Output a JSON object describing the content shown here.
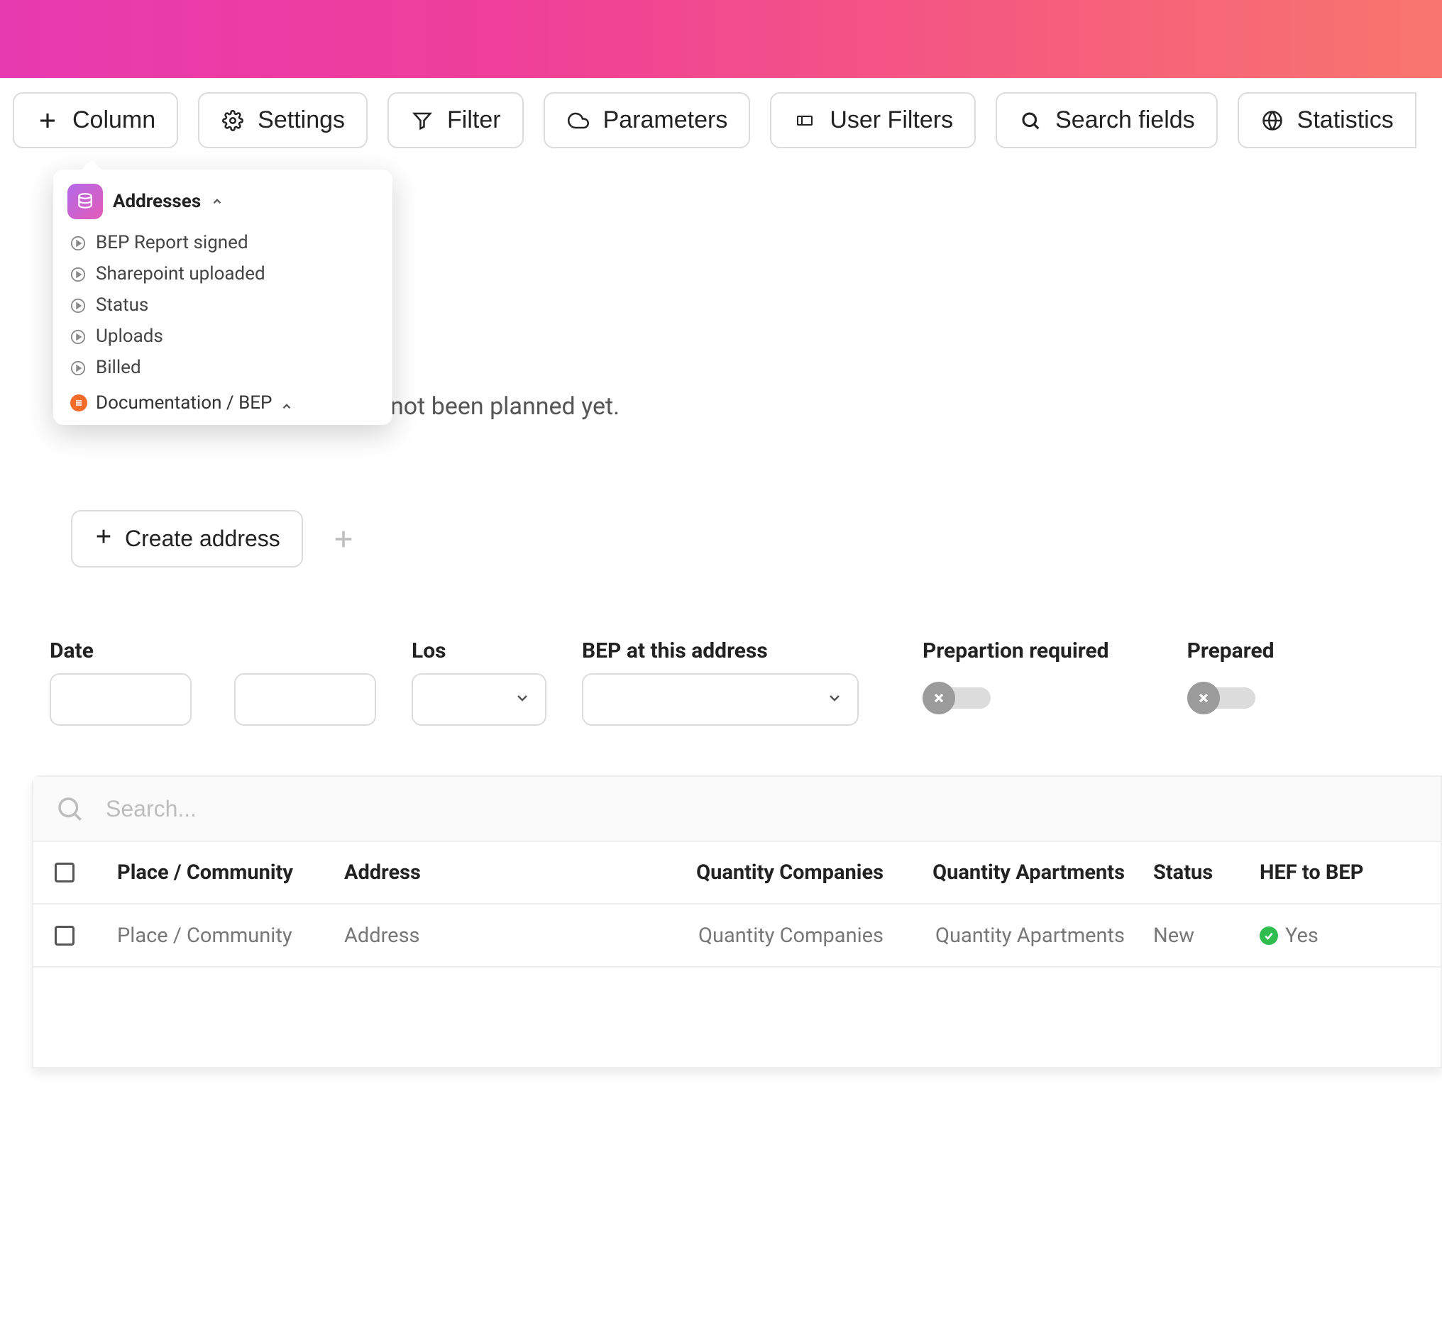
{
  "toolbar": {
    "column_label": "Column",
    "settings_label": "Settings",
    "filter_label": "Filter",
    "parameters_label": "Parameters",
    "user_filters_label": "User Filters",
    "search_fields_label": "Search fields",
    "statistics_label": "Statistics"
  },
  "popover": {
    "title": "Addresses",
    "items": [
      "BEP Report signed",
      "Sharepoint uploaded",
      "Status",
      "Uploads",
      "Billed"
    ],
    "footer": "Documentation / BEP"
  },
  "background_msg": "not been planned yet.",
  "actions": {
    "create_address_label": "Create address"
  },
  "filters": {
    "date_label": "Date",
    "los_label": "Los",
    "bep_label": "BEP at this address",
    "preparation_label": "Prepartion required",
    "prepared_label": "Prepared"
  },
  "table": {
    "search_placeholder": "Search...",
    "headers": {
      "place": "Place / Community",
      "address": "Address",
      "qty_companies": "Quantity Companies",
      "qty_apartments": "Quantity Apartments",
      "status": "Status",
      "hef": "HEF to BEP"
    },
    "row": {
      "place": "Place / Community",
      "address": "Address",
      "qty_companies": "Quantity Companies",
      "qty_apartments": "Quantity Apartments",
      "status": "New",
      "hef": "Yes"
    }
  }
}
